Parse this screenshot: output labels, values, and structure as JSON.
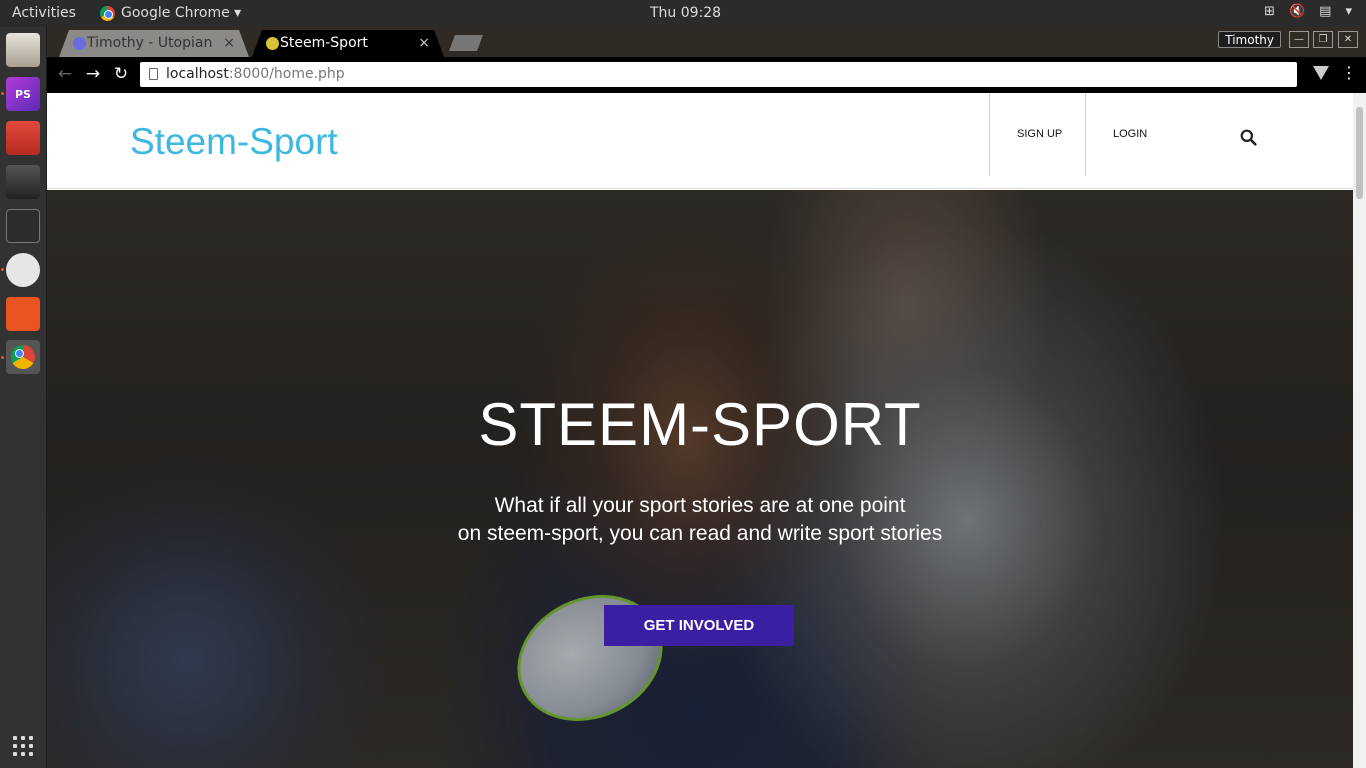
{
  "system": {
    "activities": "Activities",
    "app_menu": "Google Chrome ▾",
    "clock": "Thu 09:28",
    "tray": [
      "⊞",
      "🔇",
      "▤",
      "▾"
    ]
  },
  "dock": {
    "items": [
      "files",
      "phpstorm",
      "installer",
      "video-editor",
      "terminal",
      "updater",
      "software-center",
      "chrome"
    ],
    "ps_label": "PS"
  },
  "browser": {
    "tabs": [
      {
        "title": "Timothy - Utopian",
        "active": false
      },
      {
        "title": "Steem-Sport",
        "active": true
      }
    ],
    "profile": "Timothy",
    "url_host": "localhost",
    "url_path": ":8000/home.php",
    "close_glyph": "×"
  },
  "site": {
    "brand": "Steem-Sport",
    "nav": {
      "signup": "SIGN UP",
      "login": "LOGIN"
    },
    "hero": {
      "title": "STEEM-SPORT",
      "line1": "What if all your sport stories are at one point",
      "line2": "on steem-sport, you can read and write sport stories",
      "cta": "GET INVOLVED"
    }
  },
  "colors": {
    "brand": "#3db8e0",
    "cta": "#3b1fa3"
  }
}
